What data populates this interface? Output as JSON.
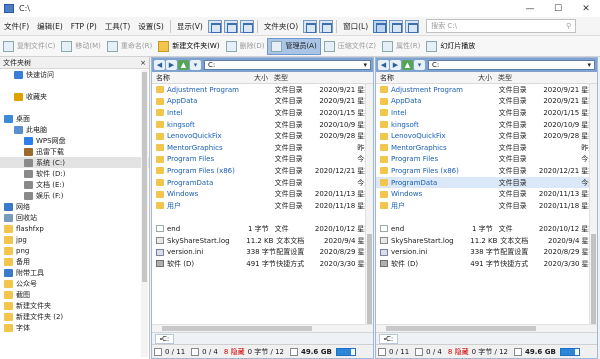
{
  "window": {
    "title": "C:\\",
    "controls": {
      "minimize": "—",
      "maximize": "☐",
      "close": "✕"
    }
  },
  "menu": {
    "items": [
      "文件(F)",
      "编辑(E)",
      "FTP (P)",
      "工具(T)",
      "设置(S)"
    ],
    "display": "显示(V)",
    "file_menu2": "文件夹(O)",
    "window_menu": "窗口(L)",
    "search_placeholder": "搜索 C:\\"
  },
  "toolbar": {
    "copy": "复制文件(C)",
    "move": "移动(M)",
    "rename": "重命名(R)",
    "new_folder": "新建文件夹(W)",
    "delete": "删除(D)",
    "admin": "管理员(A)",
    "compress": "压缩文件(Z)",
    "properties": "属性(R)",
    "slideshow": "幻灯片播放"
  },
  "tree": {
    "header": "文件夹树",
    "close": "×",
    "items": [
      {
        "label": "快速访问",
        "depth": 1,
        "icon": "star",
        "color": "#3a7fd5"
      },
      {
        "label": "",
        "depth": 0,
        "icon": "none",
        "color": ""
      },
      {
        "label": "收藏夹",
        "depth": 1,
        "icon": "star-gold",
        "color": "#e0a000"
      },
      {
        "label": "",
        "depth": 0,
        "icon": "none",
        "color": ""
      },
      {
        "label": "桌面",
        "depth": 0,
        "icon": "desktop",
        "color": "#3b8bd8"
      },
      {
        "label": "此电脑",
        "depth": 1,
        "icon": "pc",
        "color": "#5a8fcf"
      },
      {
        "label": "WPS网盘",
        "depth": 2,
        "icon": "cloud",
        "color": "#2d7ee6"
      },
      {
        "label": "迅雷下载",
        "depth": 2,
        "icon": "download",
        "color": "#9a6b2b"
      },
      {
        "label": "系统 (C:)",
        "depth": 2,
        "icon": "drive",
        "color": "#8a8a8a"
      },
      {
        "label": "软件 (D:)",
        "depth": 2,
        "icon": "drive",
        "color": "#8a8a8a"
      },
      {
        "label": "文档 (E:)",
        "depth": 2,
        "icon": "drive",
        "color": "#8a8a8a"
      },
      {
        "label": "娱乐 (F:)",
        "depth": 2,
        "icon": "drive",
        "color": "#8a8a8a"
      },
      {
        "label": "网络",
        "depth": 0,
        "icon": "network",
        "color": "#3b7ac9"
      },
      {
        "label": "回收站",
        "depth": 0,
        "icon": "recycle",
        "color": "#7a9bbd"
      },
      {
        "label": "flashfxp",
        "depth": 0,
        "icon": "folder",
        "color": "#f2c54c"
      },
      {
        "label": "jpg",
        "depth": 0,
        "icon": "folder",
        "color": "#f2c54c"
      },
      {
        "label": "png",
        "depth": 0,
        "icon": "folder",
        "color": "#f2c54c"
      },
      {
        "label": "备用",
        "depth": 0,
        "icon": "folder",
        "color": "#f2c54c"
      },
      {
        "label": "附带工具",
        "depth": 0,
        "icon": "folder-blue",
        "color": "#3b7ac9"
      },
      {
        "label": "公众号",
        "depth": 0,
        "icon": "folder",
        "color": "#f2c54c"
      },
      {
        "label": "截图",
        "depth": 0,
        "icon": "folder",
        "color": "#f2c54c"
      },
      {
        "label": "新建文件夹",
        "depth": 0,
        "icon": "folder",
        "color": "#f2c54c"
      },
      {
        "label": "新建文件夹 (2)",
        "depth": 0,
        "icon": "folder",
        "color": "#f2c54c"
      },
      {
        "label": "字体",
        "depth": 0,
        "icon": "folder",
        "color": "#f2c54c"
      }
    ]
  },
  "columns": {
    "name": "名称",
    "size": "大小",
    "type": "类型"
  },
  "panes": [
    {
      "address": "C:",
      "selected_index": -1,
      "rows": [
        {
          "name": "Adjustment Program",
          "size": "",
          "type": "文件目录",
          "date": "2020/9/21",
          "extra": "星期一",
          "icon": "folder",
          "link": true
        },
        {
          "name": "AppData",
          "size": "",
          "type": "文件目录",
          "date": "2020/9/21",
          "extra": "星期一",
          "icon": "folder",
          "link": true
        },
        {
          "name": "Intel",
          "size": "",
          "type": "文件目录",
          "date": "2020/1/15",
          "extra": "星期三",
          "icon": "folder",
          "link": true
        },
        {
          "name": "kingsoft",
          "size": "",
          "type": "文件目录",
          "date": "2020/10/9",
          "extra": "星期五",
          "icon": "folder",
          "link": true
        },
        {
          "name": "LenovoQuickFix",
          "size": "",
          "type": "文件目录",
          "date": "2020/9/28",
          "extra": "星期一",
          "icon": "folder",
          "link": true
        },
        {
          "name": "MentorGraphics",
          "size": "",
          "type": "文件目录",
          "date": "",
          "extra": "昨天",
          "icon": "folder",
          "link": true
        },
        {
          "name": "Program Files",
          "size": "",
          "type": "文件目录",
          "date": "",
          "extra": "今天",
          "icon": "folder",
          "link": true
        },
        {
          "name": "Program Files (x86)",
          "size": "",
          "type": "文件目录",
          "date": "2020/12/21",
          "extra": "星期一",
          "icon": "folder",
          "link": true
        },
        {
          "name": "ProgramData",
          "size": "",
          "type": "文件目录",
          "date": "",
          "extra": "今天",
          "icon": "folder",
          "link": true
        },
        {
          "name": "Windows",
          "size": "",
          "type": "文件目录",
          "date": "2020/11/13",
          "extra": "星期五",
          "icon": "folder",
          "link": true
        },
        {
          "name": "用户",
          "size": "",
          "type": "文件目录",
          "date": "2020/11/18",
          "extra": "星期三",
          "icon": "folder",
          "link": true
        },
        {
          "name": "",
          "size": "",
          "type": "",
          "date": "",
          "extra": "",
          "icon": "none",
          "link": false
        },
        {
          "name": "end",
          "size": "1 字节",
          "type": "文件",
          "date": "2020/10/12",
          "extra": "星期一",
          "icon": "file",
          "link": false
        },
        {
          "name": "SkyShareStart.log",
          "size": "11.2 KB",
          "type": "文本文档",
          "date": "2020/9/4",
          "extra": "星期五",
          "icon": "log",
          "link": false
        },
        {
          "name": "version.ini",
          "size": "338 字节",
          "type": "配置设置",
          "date": "2020/8/29",
          "extra": "星期六",
          "icon": "ini",
          "link": false
        },
        {
          "name": "软件 (D)",
          "size": "491 字节",
          "type": "快捷方式",
          "date": "2020/3/30",
          "extra": "星期一",
          "icon": "link",
          "link": false
        }
      ],
      "drive_tab": "C:",
      "status": {
        "sel": "0 / 11",
        "files": "0 / 4",
        "red": "8 隐藏",
        "bytes": "0 字节 / 12",
        "free": "49.6 GB",
        "fill": 0.78
      }
    },
    {
      "address": "C:",
      "selected_index": 8,
      "rows": [
        {
          "name": "Adjustment Program",
          "size": "",
          "type": "文件目录",
          "date": "2020/9/21",
          "extra": "星期一",
          "icon": "folder",
          "link": true
        },
        {
          "name": "AppData",
          "size": "",
          "type": "文件目录",
          "date": "2020/9/21",
          "extra": "星期一",
          "icon": "folder",
          "link": true
        },
        {
          "name": "Intel",
          "size": "",
          "type": "文件目录",
          "date": "2020/1/15",
          "extra": "星期三",
          "icon": "folder",
          "link": true
        },
        {
          "name": "kingsoft",
          "size": "",
          "type": "文件目录",
          "date": "2020/10/9",
          "extra": "星期五",
          "icon": "folder",
          "link": true
        },
        {
          "name": "LenovoQuickFix",
          "size": "",
          "type": "文件目录",
          "date": "2020/9/28",
          "extra": "星期一",
          "icon": "folder",
          "link": true
        },
        {
          "name": "MentorGraphics",
          "size": "",
          "type": "文件目录",
          "date": "",
          "extra": "昨天",
          "icon": "folder",
          "link": true
        },
        {
          "name": "Program Files",
          "size": "",
          "type": "文件目录",
          "date": "",
          "extra": "今天",
          "icon": "folder",
          "link": true
        },
        {
          "name": "Program Files (x86)",
          "size": "",
          "type": "文件目录",
          "date": "2020/12/21",
          "extra": "星期一",
          "icon": "folder",
          "link": true
        },
        {
          "name": "ProgramData",
          "size": "",
          "type": "文件目录",
          "date": "",
          "extra": "今天",
          "icon": "folder",
          "link": true
        },
        {
          "name": "Windows",
          "size": "",
          "type": "文件目录",
          "date": "2020/11/13",
          "extra": "星期五",
          "icon": "folder",
          "link": true
        },
        {
          "name": "用户",
          "size": "",
          "type": "文件目录",
          "date": "2020/11/18",
          "extra": "星期三",
          "icon": "folder",
          "link": true
        },
        {
          "name": "",
          "size": "",
          "type": "",
          "date": "",
          "extra": "",
          "icon": "none",
          "link": false
        },
        {
          "name": "end",
          "size": "1 字节",
          "type": "文件",
          "date": "2020/10/12",
          "extra": "星期一",
          "icon": "file",
          "link": false
        },
        {
          "name": "SkyShareStart.log",
          "size": "11.2 KB",
          "type": "文本文档",
          "date": "2020/9/4",
          "extra": "星期五",
          "icon": "log",
          "link": false
        },
        {
          "name": "version.ini",
          "size": "338 字节",
          "type": "配置设置",
          "date": "2020/8/29",
          "extra": "星期六",
          "icon": "ini",
          "link": false
        },
        {
          "name": "软件 (D)",
          "size": "491 字节",
          "type": "快捷方式",
          "date": "2020/3/30",
          "extra": "星期一",
          "icon": "link",
          "link": false
        }
      ],
      "drive_tab": "C:",
      "status": {
        "sel": "0 / 11",
        "files": "0 / 4",
        "red": "8 隐藏",
        "bytes": "0 字节 / 12",
        "free": "49.6 GB",
        "fill": 0.78
      }
    }
  ],
  "colors": {
    "accent": "#7fa2cf",
    "link": "#1a5fb4",
    "hidden_red": "#d00000",
    "selected_row": "#dbe8f7"
  }
}
